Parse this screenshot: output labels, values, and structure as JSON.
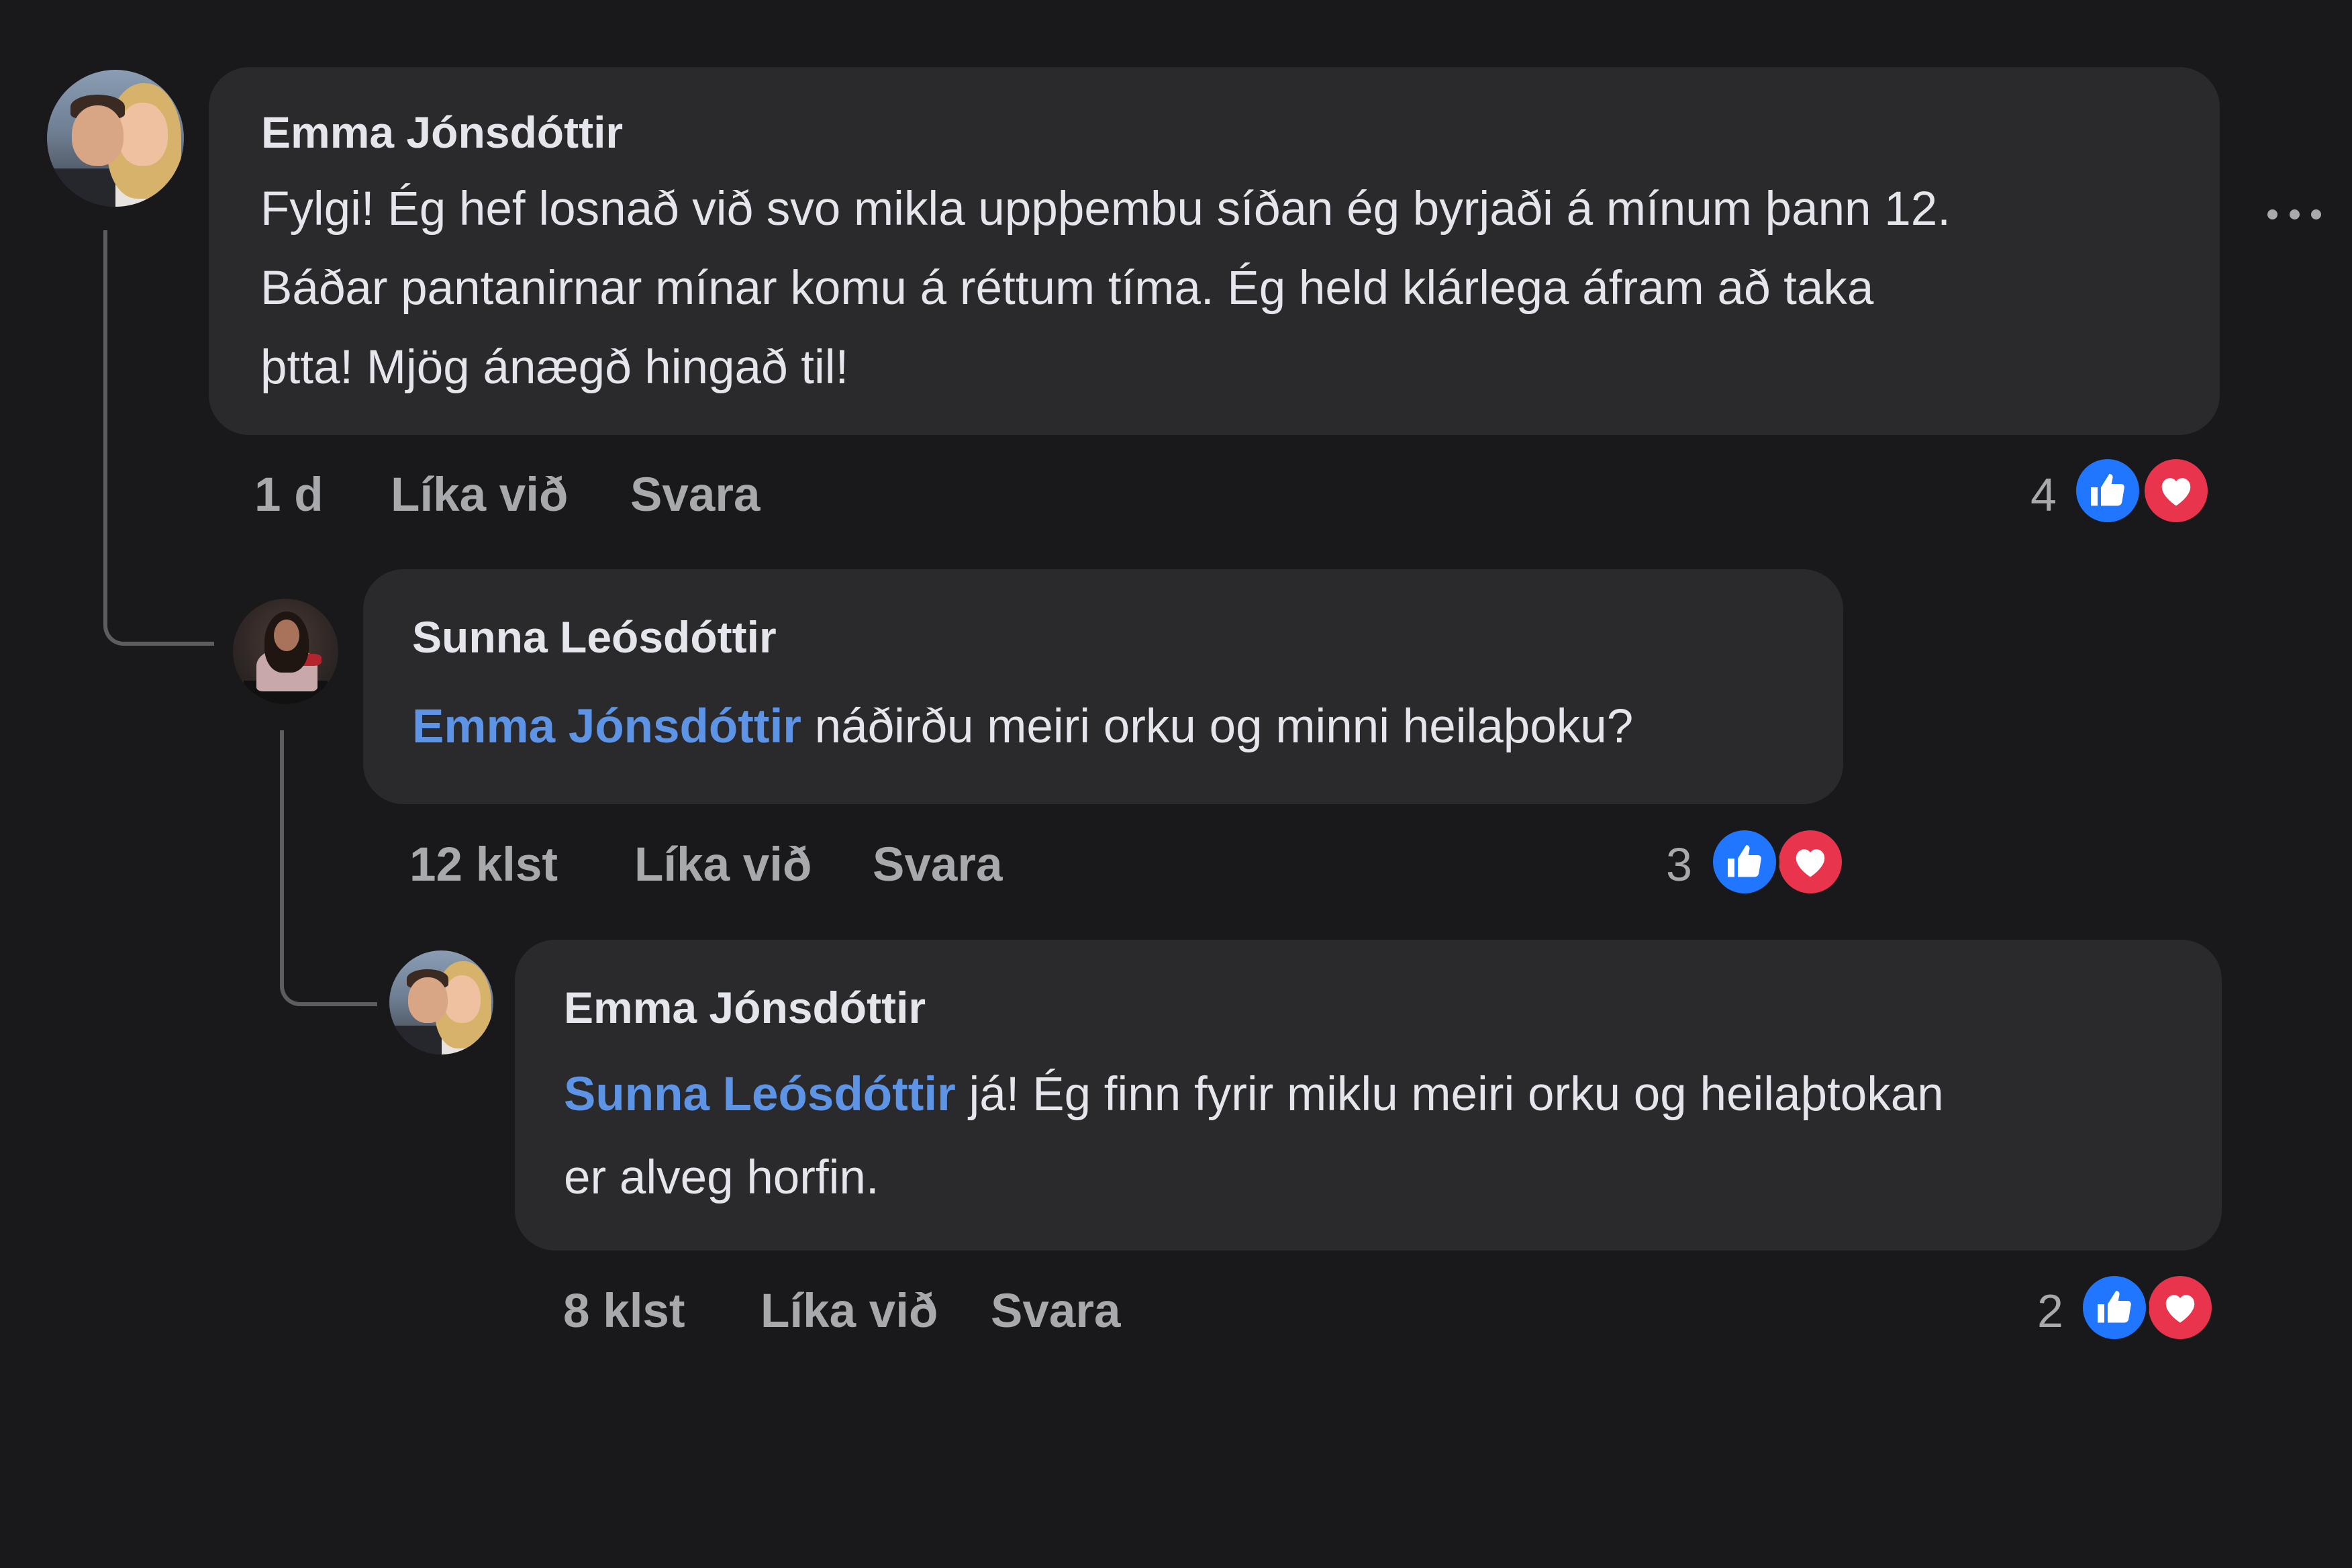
{
  "comments": [
    {
      "author": "Emma Jónsdóttir",
      "lines": [
        "Fylgi! Ég hef losnað við svo mikla uppþembu síðan ég byrjaði á mínum þann 12.",
        "Báðar pantanirnar mínar komu á réttum tíma. Ég held klárlega áfram að taka",
        "þtta! Mjög ánægð hingað til!"
      ],
      "time": "1 d",
      "like_label": "Líka við",
      "reply_label": "Svara",
      "reaction_count": "4",
      "reactions": [
        "like-icon",
        "heart-icon"
      ]
    },
    {
      "author": "Sunna Leósdóttir",
      "mention": "Emma Jónsdóttir",
      "text": " náðirðu meiri orku og minni heilaþoku?",
      "time": "12 klst",
      "like_label": "Líka við",
      "reply_label": "Svara",
      "reaction_count": "3",
      "reactions": [
        "like-icon",
        "heart-icon"
      ]
    },
    {
      "author": "Emma Jónsdóttir",
      "mention": "Sunna Leósdóttir",
      "text_line1": " já! Ég finn fyrir miklu meiri orku og heilaþtokan",
      "text_line2": "er alveg horfin.",
      "time": "8 klst",
      "like_label": "Líka við",
      "reply_label": "Svara",
      "reaction_count": "2",
      "reactions": [
        "like-icon",
        "heart-icon"
      ]
    }
  ],
  "more_options": "more-options-icon",
  "colors": {
    "background": "#19191b",
    "bubble": "#2a2a2d",
    "mention": "#5e94e5",
    "like": "#2176ff",
    "love": "#e8344c",
    "muted": "#a7a9ad"
  }
}
